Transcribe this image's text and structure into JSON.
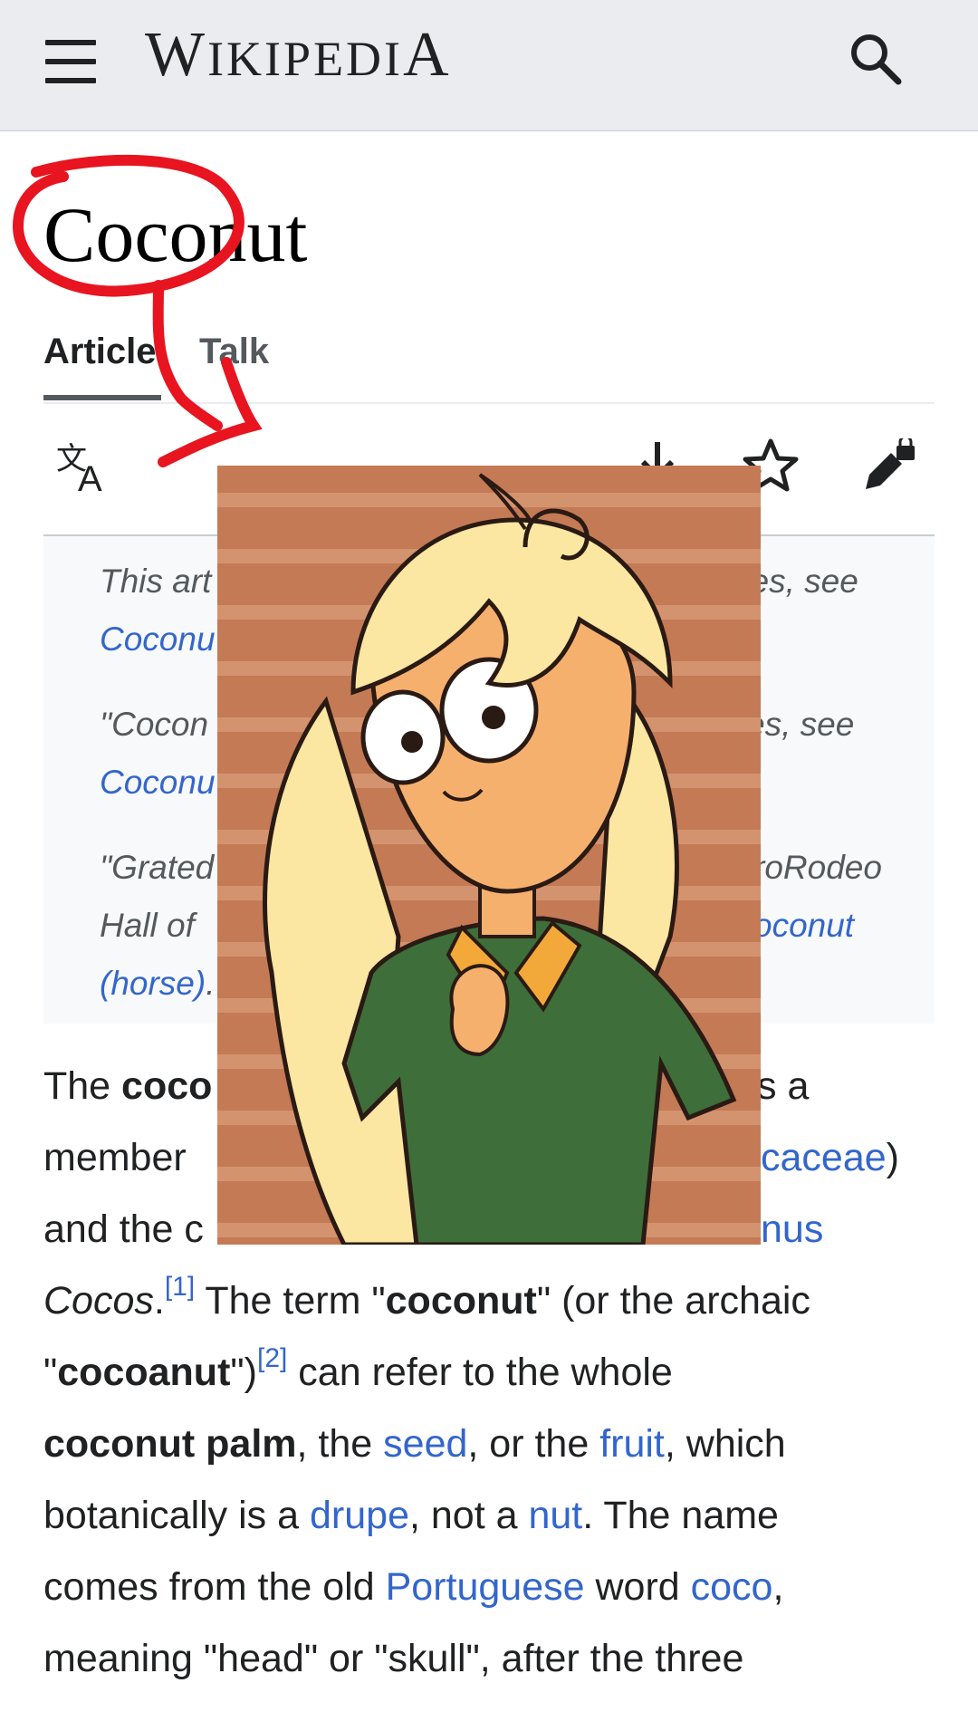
{
  "header": {
    "menu_icon": "hamburger-menu-icon",
    "wordmark_first": "W",
    "wordmark_small": "IKIPEDI",
    "wordmark_last": "A",
    "search_icon": "search-icon"
  },
  "article": {
    "title": "Coconut",
    "tabs": [
      {
        "label": "Article",
        "active": true
      },
      {
        "label": "Talk",
        "active": false
      }
    ],
    "actions": [
      "language-icon",
      "download-icon",
      "watch-star-icon",
      "edit-lock-icon"
    ]
  },
  "hatnotes": [
    {
      "pre": "This art",
      "post": "ses, see",
      "link": "Coconu"
    },
    {
      "pre": "\"Cocon",
      "post": "es, see",
      "link": "Coconu"
    },
    {
      "pre": "\"Grated",
      "post": "roRodeo",
      "line2_pre": "Hall of",
      "line2_link": "oconut",
      "line3_link": "(horse)",
      "line3_rest": "."
    }
  ],
  "body": {
    "l1_a": "The ",
    "l1_b": "coco",
    "l1_c": "s a",
    "l2_a": "member",
    "l2_link": "caceae",
    "l2_c": ")",
    "l3_a": "and the c",
    "l3_link": "nus",
    "l4_italic": "Cocos",
    "l4_b": ".",
    "l4_ref": "[1]",
    "l4_c": " The term \"",
    "l4_bold": "coconut",
    "l4_d": "\" (or the archaic",
    "l5_a": "\"",
    "l5_bold": "cocoanut",
    "l5_b": "\")",
    "l5_ref": "[2]",
    "l5_c": " can refer to the whole",
    "l6_bold": "coconut palm",
    "l6_a": ", the ",
    "l6_link1": "seed",
    "l6_b": ", or the ",
    "l6_link2": "fruit",
    "l6_c": ", which",
    "l7_a": "botanically is a ",
    "l7_link1": "drupe",
    "l7_b": ", not a ",
    "l7_link2": "nut",
    "l7_c": ". The name",
    "l8_a": "comes from the old ",
    "l8_link1": "Portuguese",
    "l8_b": " word ",
    "l8_link2": "coco",
    "l8_c": ",",
    "l9_a": "meaning \"head\" or \"skull\", after the three"
  },
  "overlay": {
    "image": "cartoon-girl-illustration",
    "background_color": "#c47a55",
    "hair_color": "#fbe6a2",
    "skin_color": "#f6b06e",
    "shirt_color": "#3e6e3a",
    "collar_color": "#f3a93a"
  },
  "annotation": {
    "color": "#e8141f",
    "shape": "red-circle-arrow"
  }
}
